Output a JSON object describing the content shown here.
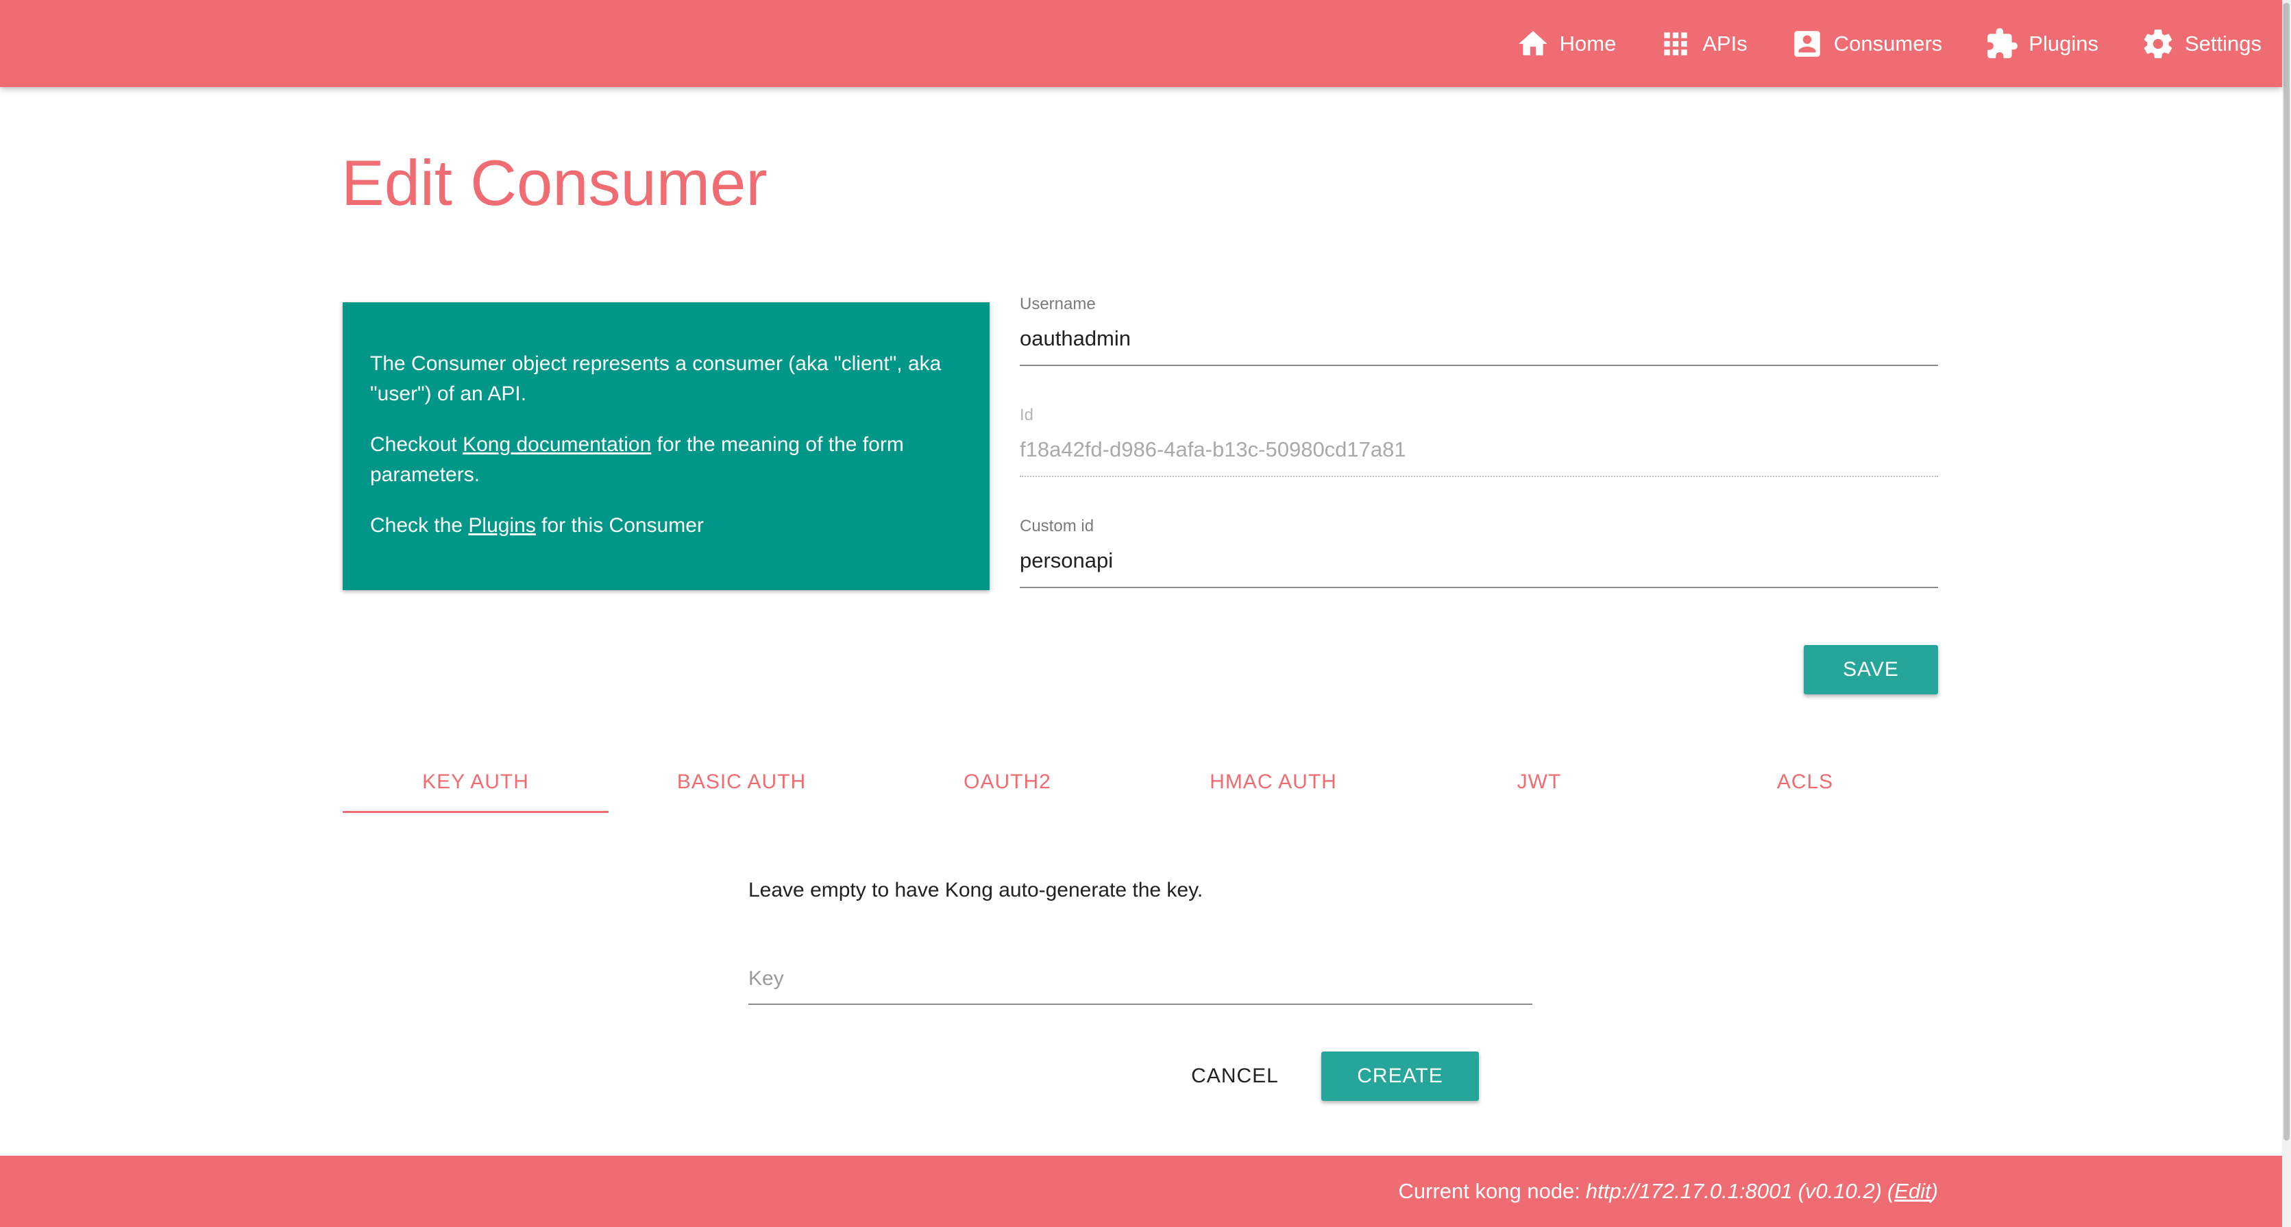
{
  "nav": {
    "items": [
      {
        "label": "Home",
        "icon": "home-icon"
      },
      {
        "label": "APIs",
        "icon": "apps-grid-icon"
      },
      {
        "label": "Consumers",
        "icon": "account-box-icon"
      },
      {
        "label": "Plugins",
        "icon": "puzzle-icon"
      },
      {
        "label": "Settings",
        "icon": "gear-icon"
      }
    ]
  },
  "page": {
    "title": "Edit Consumer"
  },
  "info": {
    "p1": "The Consumer object represents a consumer (aka \"client\", aka \"user\") of an API.",
    "p2_before": "Checkout ",
    "p2_link": "Kong documentation",
    "p2_after": " for the meaning of the form parameters.",
    "p3_before": "Check the ",
    "p3_link": "Plugins",
    "p3_after": " for this Consumer"
  },
  "form": {
    "username": {
      "label": "Username",
      "value": "oauthadmin"
    },
    "id": {
      "label": "Id",
      "value": "f18a42fd-d986-4afa-b13c-50980cd17a81"
    },
    "custom_id": {
      "label": "Custom id",
      "value": "personapi"
    },
    "save_label": "SAVE"
  },
  "tabs": [
    {
      "label": "KEY AUTH",
      "active": true
    },
    {
      "label": "BASIC AUTH",
      "active": false
    },
    {
      "label": "OAUTH2",
      "active": false
    },
    {
      "label": "HMAC AUTH",
      "active": false
    },
    {
      "label": "JWT",
      "active": false
    },
    {
      "label": "ACLS",
      "active": false
    }
  ],
  "key_auth": {
    "help": "Leave empty to have Kong auto-generate the key.",
    "key_placeholder": "Key",
    "key_value": "",
    "cancel_label": "CANCEL",
    "create_label": "CREATE"
  },
  "footer": {
    "prefix": "Current kong node:",
    "node_url": "http://172.17.0.1:8001",
    "version": "(v0.10.2)",
    "paren_open": "(",
    "edit_label": "Edit",
    "paren_close": ")"
  },
  "colors": {
    "brand": "#ef6c72",
    "teal_card": "#009688",
    "teal_button": "#26a69a"
  }
}
